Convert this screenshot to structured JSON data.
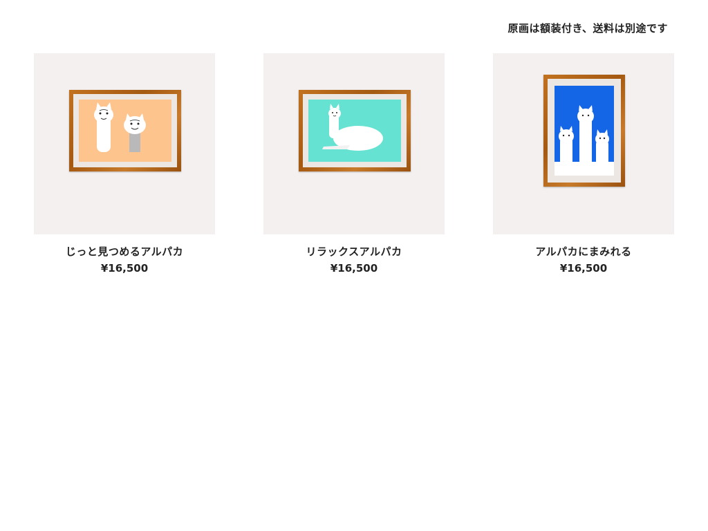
{
  "header": {
    "notice": "原画は額装付き、送料は別途です"
  },
  "products": [
    {
      "title": "じっと見つめるアルパカ",
      "price": "¥16,500",
      "art_color": "#fdc48e",
      "icon": "two-alpacas-painting-icon"
    },
    {
      "title": "リラックスアルパカ",
      "price": "¥16,500",
      "art_color": "#66e2d3",
      "icon": "resting-alpaca-painting-icon"
    },
    {
      "title": "アルパカにまみれる",
      "price": "¥16,500",
      "art_color": "#1466e6",
      "icon": "three-alpacas-painting-icon"
    }
  ],
  "colors": {
    "card_background": "#f4f0f0",
    "frame_wood": "#b8691c",
    "mat": "#ece7e3",
    "text": "#222222"
  }
}
